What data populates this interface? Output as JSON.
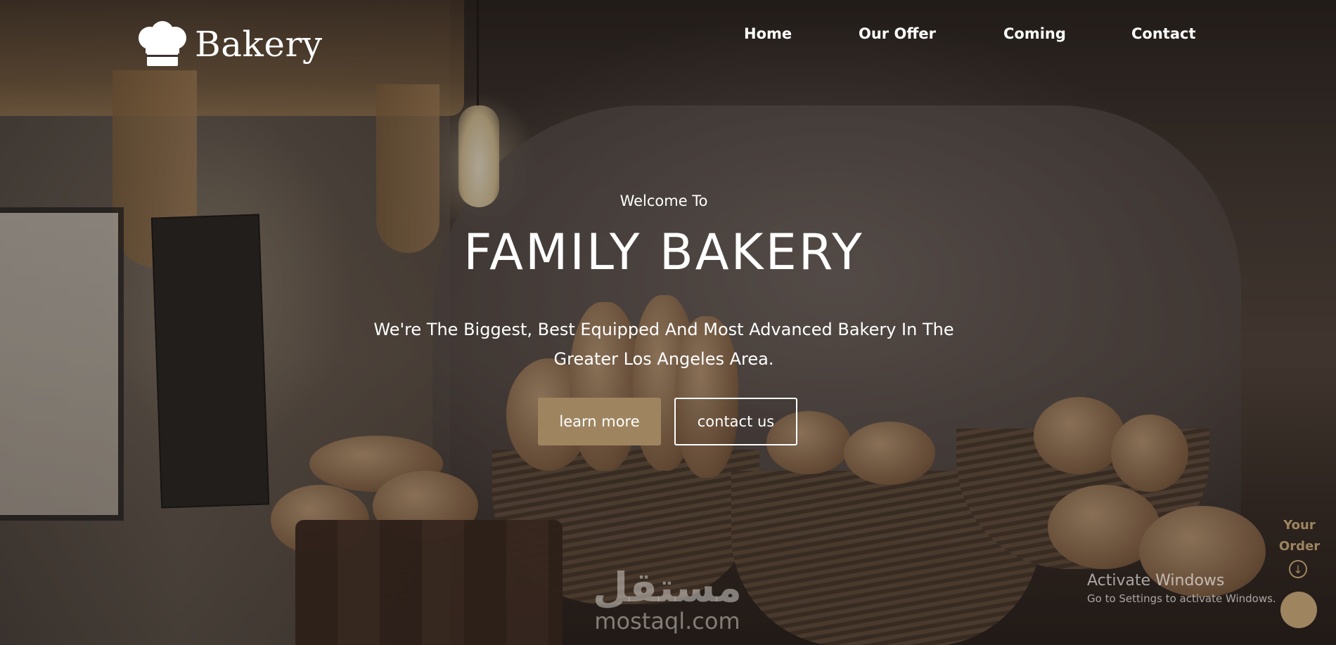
{
  "brand": {
    "name": "Bakery",
    "icon": "chef-hat-icon"
  },
  "nav": {
    "items": [
      "Home",
      "Our Offer",
      "Coming",
      "Contact"
    ]
  },
  "hero": {
    "welcome": "Welcome To",
    "title": "FAMILY BAKERY",
    "subtitle": "We're The Biggest, Best Equipped And Most Advanced Bakery In The Greater Los Angeles Area.",
    "primary_button": "learn more",
    "secondary_button": "contact us"
  },
  "order_widget": {
    "label": "Your Order",
    "icon": "arrow-down-circle-icon"
  },
  "system_overlay": {
    "activate_title": "Activate Windows",
    "activate_sub": "Go to Settings to activate Windows."
  },
  "watermark": {
    "arabic": "مستقل",
    "latin": "mostaql.com"
  },
  "colors": {
    "accent": "#9e8560",
    "text": "#ffffff",
    "overlay": "#120c09"
  }
}
